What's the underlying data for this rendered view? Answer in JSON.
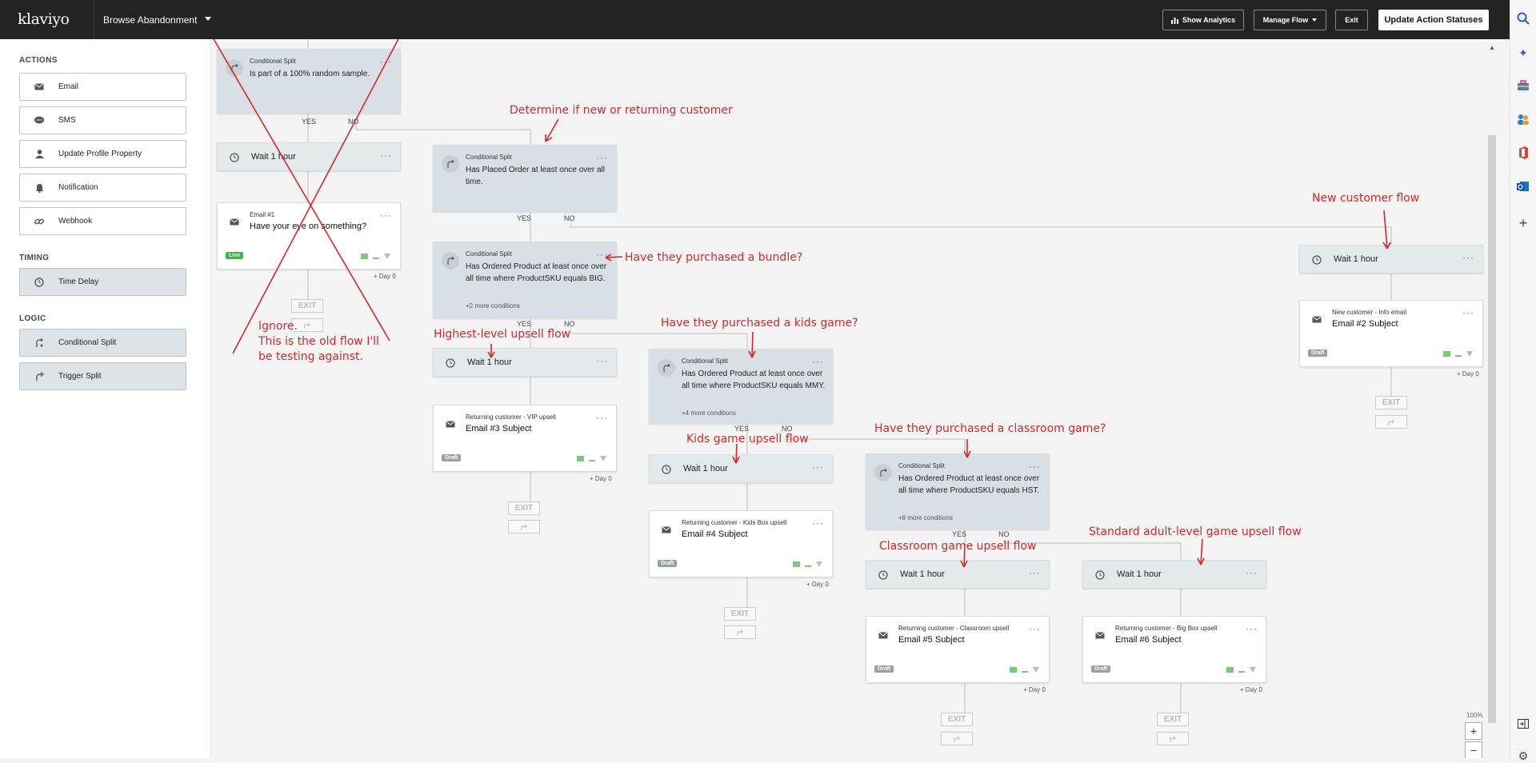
{
  "topbar": {
    "logo": "klaviyo",
    "flow_name": "Browse Abandonment",
    "show_analytics": "Show Analytics",
    "manage_flow": "Manage Flow",
    "exit": "Exit",
    "update_statuses": "Update Action Statuses"
  },
  "sidebar": {
    "actions_title": "ACTIONS",
    "actions": [
      "Email",
      "SMS",
      "Update Profile Property",
      "Notification",
      "Webhook"
    ],
    "timing_title": "TIMING",
    "timing": [
      "Time Delay"
    ],
    "logic_title": "LOGIC",
    "logic": [
      "Conditional Split",
      "Trigger Split"
    ]
  },
  "flow": {
    "split0": {
      "cap": "Conditional Split",
      "text": "Is part of a 100% random sample."
    },
    "wait0": {
      "text": "Wait 1 hour"
    },
    "email1": {
      "cap": "Email #1",
      "subject": "Have your eye on something?",
      "badge": "Live",
      "day": "+ Day 0"
    },
    "split1": {
      "cap": "Conditional Split",
      "text": "Has Placed Order at least once over all time."
    },
    "split2": {
      "cap": "Conditional Split",
      "text": "Has Ordered Product at least once over all time where ProductSKU equals BIG.",
      "more": "+2 more conditions"
    },
    "wait2": {
      "text": "Wait 1 hour"
    },
    "email3": {
      "cap": "Returning customer - VIP upsell",
      "subject": "Email #3 Subject",
      "badge": "Draft",
      "day": "+ Day 0"
    },
    "split3": {
      "cap": "Conditional Split",
      "text": "Has Ordered Product at least once over all time where ProductSKU equals MMY.",
      "more": "+4 more conditions"
    },
    "wait3": {
      "text": "Wait 1 hour"
    },
    "email4": {
      "cap": "Returning customer - Kids Box upsell",
      "subject": "Email #4 Subject",
      "badge": "Draft",
      "day": "+ Day 0"
    },
    "split4": {
      "cap": "Conditional Split",
      "text": "Has Ordered Product at least once over all time where ProductSKU equals HST.",
      "more": "+8 more conditions"
    },
    "wait5": {
      "text": "Wait 1 hour"
    },
    "email5": {
      "cap": "Returning customer - Classroom upsell",
      "subject": "Email #5 Subject",
      "badge": "Draft",
      "day": "+ Day 0"
    },
    "wait6": {
      "text": "Wait 1 hour"
    },
    "email6": {
      "cap": "Returning customer - Big Box upsell",
      "subject": "Email #6 Subject",
      "badge": "Draft",
      "day": "+ Day 0"
    },
    "waitN": {
      "text": "Wait 1 hour"
    },
    "email2": {
      "cap": "New customer - Info email",
      "subject": "Email #2 Subject",
      "badge": "Draft",
      "day": "+ Day 0"
    },
    "yes": "YES",
    "no": "NO",
    "exit": "EXIT"
  },
  "annotations": {
    "determine": "Determine if new or returning customer",
    "new_flow": "New customer flow",
    "bundle": "Have they purchased a bundle?",
    "kids_game": "Have they purchased a kids game?",
    "highest": "Highest-level upsell flow",
    "ignore": "Ignore.\nThis is the old flow I'll\nbe testing against.",
    "kids_flow": "Kids game upsell flow",
    "classroom_q": "Have they purchased a classroom game?",
    "classroom_flow": "Classroom game upsell flow",
    "standard_flow": "Standard adult-level game upsell flow"
  },
  "zoom": {
    "level": "100%"
  },
  "colors": {
    "topbar": "#232323",
    "annotation": "#d9262b",
    "split_card": "#d9e0e5",
    "live": "#3ab54a"
  }
}
